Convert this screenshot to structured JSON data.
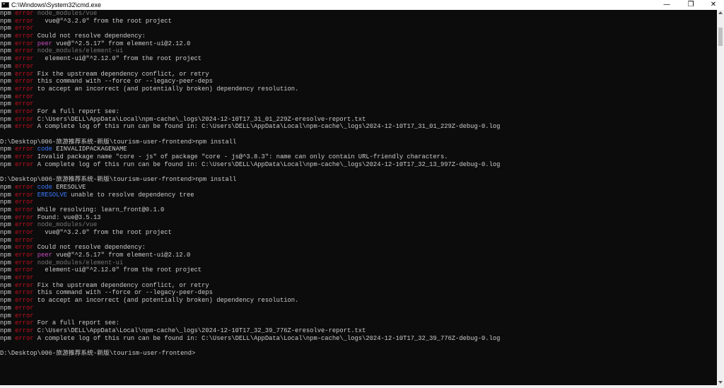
{
  "window": {
    "title": "C:\\Windows\\System32\\cmd.exe",
    "minimize_glyph": "—",
    "maximize_glyph": "❐",
    "close_glyph": "✕"
  },
  "colors": {
    "background": "#0c0c0c",
    "text": "#cccccc",
    "error": "#c50f1f",
    "code": "#3b78ff",
    "peer": "#c94fc2",
    "dim": "#767676"
  },
  "console": {
    "lines": [
      [
        [
          "npm ",
          "npm"
        ],
        [
          "error",
          "err"
        ],
        [
          " node_modules/vue",
          "dim"
        ]
      ],
      [
        [
          "npm ",
          "npm"
        ],
        [
          "error",
          "err"
        ],
        [
          "   vue@\"^3.2.0\" from the root project",
          "txt"
        ]
      ],
      [
        [
          "npm ",
          "npm"
        ],
        [
          "error",
          "err"
        ]
      ],
      [
        [
          "npm ",
          "npm"
        ],
        [
          "error",
          "err"
        ],
        [
          " Could not resolve dependency:",
          "txt"
        ]
      ],
      [
        [
          "npm ",
          "npm"
        ],
        [
          "error",
          "err"
        ],
        [
          " peer",
          "peer"
        ],
        [
          " vue@\"^2.5.17\" from element-ui@2.12.0",
          "txt"
        ]
      ],
      [
        [
          "npm ",
          "npm"
        ],
        [
          "error",
          "err"
        ],
        [
          " node_modules/element-ui",
          "dim"
        ]
      ],
      [
        [
          "npm ",
          "npm"
        ],
        [
          "error",
          "err"
        ],
        [
          "   element-ui@\"^2.12.0\" from the root project",
          "txt"
        ]
      ],
      [
        [
          "npm ",
          "npm"
        ],
        [
          "error",
          "err"
        ]
      ],
      [
        [
          "npm ",
          "npm"
        ],
        [
          "error",
          "err"
        ],
        [
          " Fix the upstream dependency conflict, or retry",
          "txt"
        ]
      ],
      [
        [
          "npm ",
          "npm"
        ],
        [
          "error",
          "err"
        ],
        [
          " this command with --force or --legacy-peer-deps",
          "txt"
        ]
      ],
      [
        [
          "npm ",
          "npm"
        ],
        [
          "error",
          "err"
        ],
        [
          " to accept an incorrect (and potentially broken) dependency resolution.",
          "txt"
        ]
      ],
      [
        [
          "npm ",
          "npm"
        ],
        [
          "error",
          "err"
        ]
      ],
      [
        [
          "npm ",
          "npm"
        ],
        [
          "error",
          "err"
        ]
      ],
      [
        [
          "npm ",
          "npm"
        ],
        [
          "error",
          "err"
        ],
        [
          " For a full report see:",
          "txt"
        ]
      ],
      [
        [
          "npm ",
          "npm"
        ],
        [
          "error",
          "err"
        ],
        [
          " C:\\Users\\DELL\\AppData\\Local\\npm-cache\\_logs\\2024-12-10T17_31_01_229Z-eresolve-report.txt",
          "txt"
        ]
      ],
      [
        [
          "npm ",
          "npm"
        ],
        [
          "error",
          "err"
        ],
        [
          " A complete log of this run can be found in: C:\\Users\\DELL\\AppData\\Local\\npm-cache\\_logs\\2024-12-10T17_31_01_229Z-debug-0.log",
          "txt"
        ]
      ],
      [],
      [
        [
          "D:\\Desktop\\006-旅游推荐系统-新版\\tourism-user-frontend>npm install",
          "txt"
        ]
      ],
      [
        [
          "npm ",
          "npm"
        ],
        [
          "error",
          "err"
        ],
        [
          " code",
          "code"
        ],
        [
          " EINVALIDPACKAGENAME",
          "txt"
        ]
      ],
      [
        [
          "npm ",
          "npm"
        ],
        [
          "error",
          "err"
        ],
        [
          " Invalid package name \"core - js\" of package \"core - js@^3.8.3\": name can only contain URL-friendly characters.",
          "txt"
        ]
      ],
      [
        [
          "npm ",
          "npm"
        ],
        [
          "error",
          "err"
        ],
        [
          " A complete log of this run can be found in: C:\\Users\\DELL\\AppData\\Local\\npm-cache\\_logs\\2024-12-10T17_32_13_997Z-debug-0.log",
          "txt"
        ]
      ],
      [],
      [
        [
          "D:\\Desktop\\006-旅游推荐系统-新版\\tourism-user-frontend>npm install",
          "txt"
        ]
      ],
      [
        [
          "npm ",
          "npm"
        ],
        [
          "error",
          "err"
        ],
        [
          " code",
          "code"
        ],
        [
          " ERESOLVE",
          "txt"
        ]
      ],
      [
        [
          "npm ",
          "npm"
        ],
        [
          "error",
          "err"
        ],
        [
          " ERESOLVE",
          "code"
        ],
        [
          " unable to resolve dependency tree",
          "txt"
        ]
      ],
      [
        [
          "npm ",
          "npm"
        ],
        [
          "error",
          "err"
        ]
      ],
      [
        [
          "npm ",
          "npm"
        ],
        [
          "error",
          "err"
        ],
        [
          " While resolving: learn_front@0.1.0",
          "txt"
        ]
      ],
      [
        [
          "npm ",
          "npm"
        ],
        [
          "error",
          "err"
        ],
        [
          " Found: vue@3.5.13",
          "txt"
        ]
      ],
      [
        [
          "npm ",
          "npm"
        ],
        [
          "error",
          "err"
        ],
        [
          " node_modules/vue",
          "dim"
        ]
      ],
      [
        [
          "npm ",
          "npm"
        ],
        [
          "error",
          "err"
        ],
        [
          "   vue@\"^3.2.0\" from the root project",
          "txt"
        ]
      ],
      [
        [
          "npm ",
          "npm"
        ],
        [
          "error",
          "err"
        ]
      ],
      [
        [
          "npm ",
          "npm"
        ],
        [
          "error",
          "err"
        ],
        [
          " Could not resolve dependency:",
          "txt"
        ]
      ],
      [
        [
          "npm ",
          "npm"
        ],
        [
          "error",
          "err"
        ],
        [
          " peer",
          "peer"
        ],
        [
          " vue@\"^2.5.17\" from element-ui@2.12.0",
          "txt"
        ]
      ],
      [
        [
          "npm ",
          "npm"
        ],
        [
          "error",
          "err"
        ],
        [
          " node_modules/element-ui",
          "dim"
        ]
      ],
      [
        [
          "npm ",
          "npm"
        ],
        [
          "error",
          "err"
        ],
        [
          "   element-ui@\"^2.12.0\" from the root project",
          "txt"
        ]
      ],
      [
        [
          "npm ",
          "npm"
        ],
        [
          "error",
          "err"
        ]
      ],
      [
        [
          "npm ",
          "npm"
        ],
        [
          "error",
          "err"
        ],
        [
          " Fix the upstream dependency conflict, or retry",
          "txt"
        ]
      ],
      [
        [
          "npm ",
          "npm"
        ],
        [
          "error",
          "err"
        ],
        [
          " this command with --force or --legacy-peer-deps",
          "txt"
        ]
      ],
      [
        [
          "npm ",
          "npm"
        ],
        [
          "error",
          "err"
        ],
        [
          " to accept an incorrect (and potentially broken) dependency resolution.",
          "txt"
        ]
      ],
      [
        [
          "npm ",
          "npm"
        ],
        [
          "error",
          "err"
        ]
      ],
      [
        [
          "npm ",
          "npm"
        ],
        [
          "error",
          "err"
        ]
      ],
      [
        [
          "npm ",
          "npm"
        ],
        [
          "error",
          "err"
        ],
        [
          " For a full report see:",
          "txt"
        ]
      ],
      [
        [
          "npm ",
          "npm"
        ],
        [
          "error",
          "err"
        ],
        [
          " C:\\Users\\DELL\\AppData\\Local\\npm-cache\\_logs\\2024-12-10T17_32_39_776Z-eresolve-report.txt",
          "txt"
        ]
      ],
      [
        [
          "npm ",
          "npm"
        ],
        [
          "error",
          "err"
        ],
        [
          " A complete log of this run can be found in: C:\\Users\\DELL\\AppData\\Local\\npm-cache\\_logs\\2024-12-10T17_32_39_776Z-debug-0.log",
          "txt"
        ]
      ],
      [],
      [
        [
          "D:\\Desktop\\006-旅游推荐系统-新版\\tourism-user-frontend>",
          "txt"
        ]
      ]
    ]
  }
}
